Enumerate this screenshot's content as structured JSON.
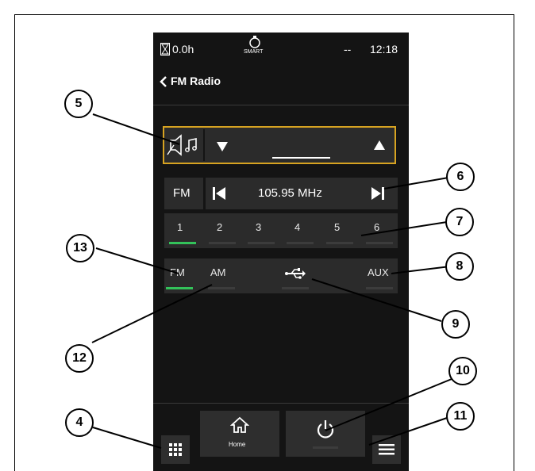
{
  "status_bar": {
    "hours": "0.0h",
    "smart_label": "SMART",
    "dash": "--",
    "time": "12:18"
  },
  "header": {
    "title": "FM Radio"
  },
  "tuner": {
    "band_label": "FM",
    "frequency": "105.95 MHz"
  },
  "presets": [
    "1",
    "2",
    "3",
    "4",
    "5",
    "6"
  ],
  "active_preset": "1",
  "sources": {
    "fm": "FM",
    "am": "AM",
    "aux": "AUX",
    "active": "FM"
  },
  "bottom_bar": {
    "home_label": "Home"
  },
  "callouts": [
    "5",
    "6",
    "7",
    "8",
    "9",
    "10",
    "11",
    "12",
    "13",
    "4"
  ],
  "colors": {
    "highlight_border": "#d7a321",
    "active_indicator": "#33c25a",
    "screen_bg": "#141414"
  },
  "icons": [
    "hourglass-icon",
    "smart-bell-icon",
    "back-chevron-icon",
    "speaker-music-icon",
    "volume-down-icon",
    "volume-up-icon",
    "seek-previous-icon",
    "seek-next-icon",
    "usb-icon",
    "grid-icon",
    "home-icon",
    "power-icon",
    "menu-icon"
  ]
}
